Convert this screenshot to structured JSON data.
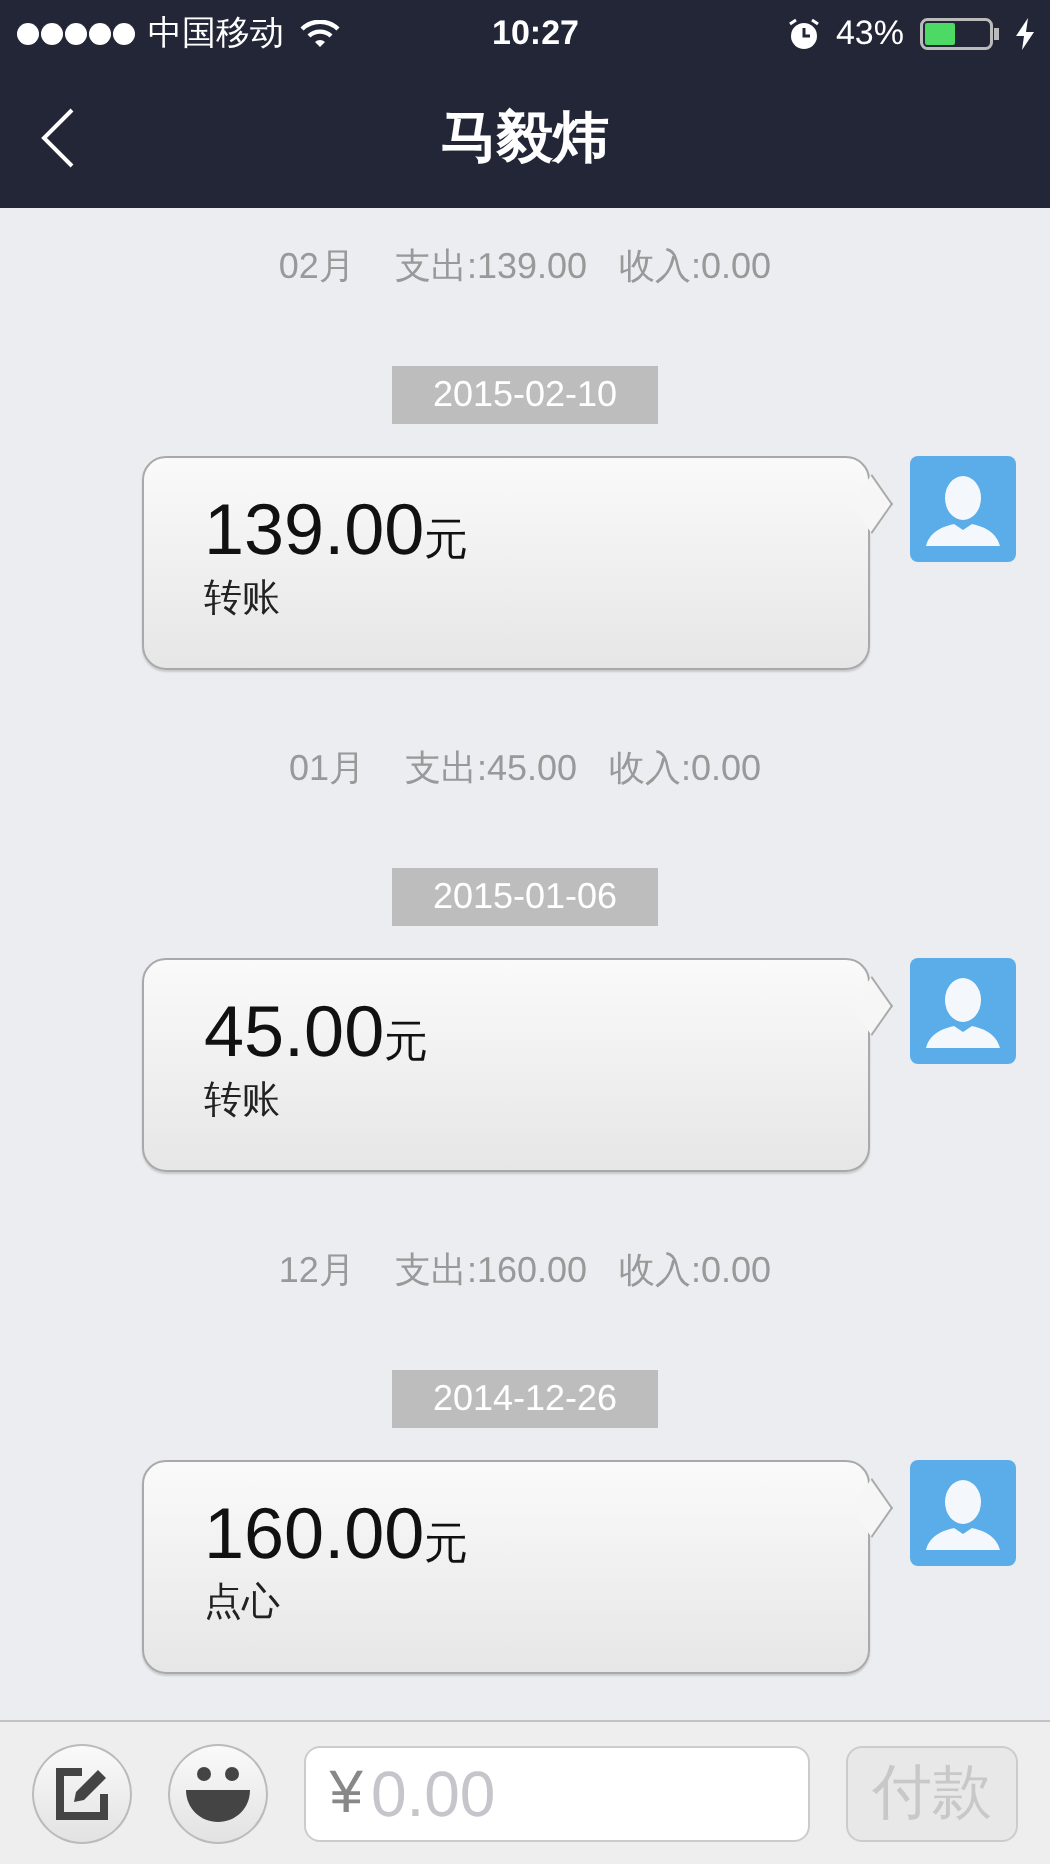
{
  "status_bar": {
    "carrier": "中国移动",
    "time": "10:27",
    "battery_percent": "43%",
    "charging": true
  },
  "nav": {
    "title": "马毅炜"
  },
  "groups": [
    {
      "month": "02月",
      "expense": "支出:139.00",
      "income": "收入:0.00",
      "date": "2015-02-10",
      "amount": "139.00",
      "unit": "元",
      "memo": "转账"
    },
    {
      "month": "01月",
      "expense": "支出:45.00",
      "income": "收入:0.00",
      "date": "2015-01-06",
      "amount": "45.00",
      "unit": "元",
      "memo": "转账"
    },
    {
      "month": "12月",
      "expense": "支出:160.00",
      "income": "收入:0.00",
      "date": "2014-12-26",
      "amount": "160.00",
      "unit": "元",
      "memo": "点心"
    }
  ],
  "input_bar": {
    "currency": "¥",
    "placeholder": "0.00",
    "pay_button": {
      "label": "付款",
      "disabled": true
    }
  }
}
